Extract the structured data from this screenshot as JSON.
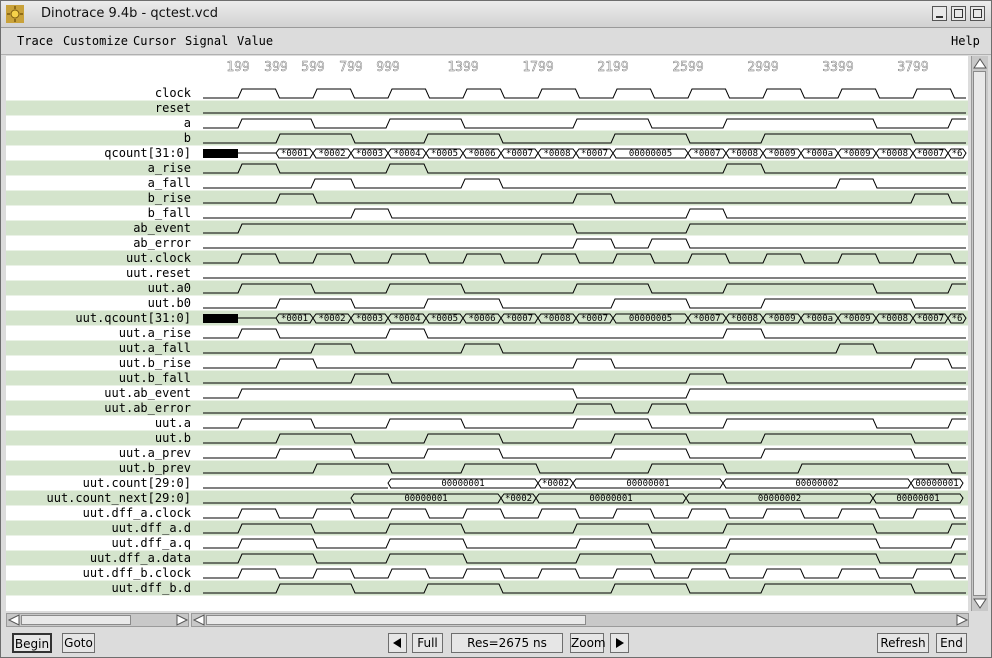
{
  "window": {
    "title": "Dinotrace 9.4b - qctest.vcd"
  },
  "menu": [
    "Trace",
    "Customize",
    "Cursor",
    "Signal",
    "Value",
    "Help"
  ],
  "time_labels": [
    "199",
    "399",
    "599",
    "799",
    "999",
    "1399",
    "1799",
    "2199",
    "2599",
    "2999",
    "3399",
    "3799"
  ],
  "signals": [
    {
      "name": "clock",
      "type": "clk",
      "period": 75,
      "phase": 37
    },
    {
      "name": "reset",
      "type": "low"
    },
    {
      "name": "a",
      "type": "bits",
      "t": [
        202,
        237,
        310,
        385,
        460,
        572,
        647,
        722,
        872,
        947
      ],
      "start": 0
    },
    {
      "name": "b",
      "type": "bits",
      "t": [
        202,
        275,
        350,
        423,
        498,
        610,
        685,
        760,
        910
      ],
      "start": 0
    },
    {
      "name": "qcount[31:0]",
      "type": "bus",
      "segments": [
        [
          202,
          237,
          "X"
        ],
        [
          275,
          312,
          "*0001"
        ],
        [
          312,
          350,
          "*0002"
        ],
        [
          350,
          387,
          "*0003"
        ],
        [
          387,
          425,
          "*0004"
        ],
        [
          425,
          462,
          "*0005"
        ],
        [
          462,
          500,
          "*0006"
        ],
        [
          500,
          537,
          "*0007"
        ],
        [
          537,
          575,
          "*0008"
        ],
        [
          575,
          612,
          "*0007"
        ],
        [
          612,
          687,
          "00000005"
        ],
        [
          687,
          725,
          "*0007"
        ],
        [
          725,
          762,
          "*0008"
        ],
        [
          762,
          800,
          "*0009"
        ],
        [
          800,
          837,
          "*000a"
        ],
        [
          837,
          875,
          "*0009"
        ],
        [
          875,
          912,
          "*0008"
        ],
        [
          912,
          947,
          "*0007"
        ],
        [
          947,
          965,
          "*6"
        ]
      ]
    },
    {
      "name": "a_rise",
      "type": "bits",
      "t": [
        202,
        237,
        275,
        385,
        423,
        722,
        760
      ],
      "start": 0
    },
    {
      "name": "a_fall",
      "type": "bits",
      "t": [
        202,
        310,
        350,
        460,
        498,
        835,
        872
      ],
      "start": 0
    },
    {
      "name": "b_rise",
      "type": "bits",
      "t": [
        202,
        275,
        312,
        572,
        610,
        910,
        947
      ],
      "start": 0
    },
    {
      "name": "b_fall",
      "type": "bits",
      "t": [
        202,
        350,
        387,
        685,
        722
      ],
      "start": 0
    },
    {
      "name": "ab_event",
      "type": "bits",
      "t": [
        202,
        237,
        572,
        685
      ],
      "start": 0
    },
    {
      "name": "ab_error",
      "type": "bits",
      "t": [
        202,
        572,
        610,
        647,
        685
      ],
      "start": 0
    },
    {
      "name": "uut.clock",
      "type": "clk",
      "period": 75,
      "phase": 37
    },
    {
      "name": "uut.reset",
      "type": "low"
    },
    {
      "name": "uut.a0",
      "type": "bits",
      "t": [
        202,
        237,
        310,
        385,
        460,
        572,
        647,
        722,
        872,
        947
      ],
      "start": 0
    },
    {
      "name": "uut.b0",
      "type": "bits",
      "t": [
        202,
        275,
        350,
        423,
        498,
        610,
        685,
        760,
        910
      ],
      "start": 0
    },
    {
      "name": "uut.qcount[31:0]",
      "type": "bus",
      "segments": [
        [
          202,
          237,
          "X"
        ],
        [
          275,
          312,
          "*0001"
        ],
        [
          312,
          350,
          "*0002"
        ],
        [
          350,
          387,
          "*0003"
        ],
        [
          387,
          425,
          "*0004"
        ],
        [
          425,
          462,
          "*0005"
        ],
        [
          462,
          500,
          "*0006"
        ],
        [
          500,
          537,
          "*0007"
        ],
        [
          537,
          575,
          "*0008"
        ],
        [
          575,
          612,
          "*0007"
        ],
        [
          612,
          687,
          "00000005"
        ],
        [
          687,
          725,
          "*0007"
        ],
        [
          725,
          762,
          "*0008"
        ],
        [
          762,
          800,
          "*0009"
        ],
        [
          800,
          837,
          "*000a"
        ],
        [
          837,
          875,
          "*0009"
        ],
        [
          875,
          912,
          "*0008"
        ],
        [
          912,
          947,
          "*0007"
        ],
        [
          947,
          965,
          "*6"
        ]
      ]
    },
    {
      "name": "uut.a_rise",
      "type": "bits",
      "t": [
        202,
        237,
        275,
        385,
        423,
        722,
        760
      ],
      "start": 0
    },
    {
      "name": "uut.a_fall",
      "type": "bits",
      "t": [
        202,
        310,
        350,
        460,
        498,
        835,
        872
      ],
      "start": 0
    },
    {
      "name": "uut.b_rise",
      "type": "bits",
      "t": [
        202,
        275,
        312,
        572,
        610,
        910,
        947
      ],
      "start": 0
    },
    {
      "name": "uut.b_fall",
      "type": "bits",
      "t": [
        202,
        350,
        387,
        685,
        722
      ],
      "start": 0
    },
    {
      "name": "uut.ab_event",
      "type": "bits",
      "t": [
        202,
        237,
        572,
        685
      ],
      "start": 0
    },
    {
      "name": "uut.ab_error",
      "type": "bits",
      "t": [
        202,
        572,
        610,
        647,
        685
      ],
      "start": 0
    },
    {
      "name": "uut.a",
      "type": "bits",
      "t": [
        202,
        237,
        310,
        385,
        460,
        572,
        647,
        722,
        872,
        947
      ],
      "start": 0
    },
    {
      "name": "uut.b",
      "type": "bits",
      "t": [
        202,
        275,
        350,
        423,
        498,
        610,
        685,
        760,
        910
      ],
      "start": 0
    },
    {
      "name": "uut.a_prev",
      "type": "bits",
      "t": [
        202,
        275,
        350,
        423,
        498,
        610,
        685,
        760,
        910
      ],
      "start": 0
    },
    {
      "name": "uut.b_prev",
      "type": "bits",
      "t": [
        202,
        312,
        387,
        460,
        535,
        647,
        722,
        797,
        947
      ],
      "start": 0
    },
    {
      "name": "uut.count[29:0]",
      "type": "bus",
      "segments": [
        [
          202,
          387,
          ""
        ],
        [
          387,
          537,
          "00000001"
        ],
        [
          537,
          572,
          "*0002"
        ],
        [
          572,
          722,
          "00000001"
        ],
        [
          722,
          910,
          "00000002"
        ],
        [
          910,
          962,
          "00000001"
        ]
      ]
    },
    {
      "name": "uut.count_next[29:0]",
      "type": "bus",
      "segments": [
        [
          202,
          350,
          ""
        ],
        [
          350,
          500,
          "00000001"
        ],
        [
          500,
          535,
          "*0002"
        ],
        [
          535,
          685,
          "00000001"
        ],
        [
          685,
          872,
          "00000002"
        ],
        [
          872,
          962,
          "00000001"
        ]
      ]
    },
    {
      "name": "uut.dff_a.clock",
      "type": "clk",
      "period": 75,
      "phase": 37
    },
    {
      "name": "uut.dff_a.d",
      "type": "bits",
      "t": [
        202,
        237,
        310,
        385,
        460,
        572,
        647,
        722,
        872,
        947
      ],
      "start": 0
    },
    {
      "name": "uut.dff_a.q",
      "type": "bits",
      "t": [
        202,
        237,
        312,
        385,
        462,
        575,
        650,
        725,
        875,
        950
      ],
      "start": 0
    },
    {
      "name": "uut.dff_a.data",
      "type": "bits",
      "t": [
        202,
        237,
        312,
        385,
        462,
        575,
        650,
        725,
        875,
        950
      ],
      "start": 0
    },
    {
      "name": "uut.dff_b.clock",
      "type": "clk",
      "period": 75,
      "phase": 37
    },
    {
      "name": "uut.dff_b.d",
      "type": "bits",
      "t": [
        202,
        275,
        350,
        423,
        498,
        610,
        685,
        760,
        910
      ],
      "start": 0
    }
  ],
  "buttons": {
    "begin": "Begin",
    "goto": "Goto",
    "full": "Full",
    "res": "Res=2675 ns",
    "zoom": "Zoom",
    "refresh": "Refresh",
    "end": "End"
  },
  "colors": {
    "stripe": "#d4e4cc",
    "wave": "#000000"
  }
}
